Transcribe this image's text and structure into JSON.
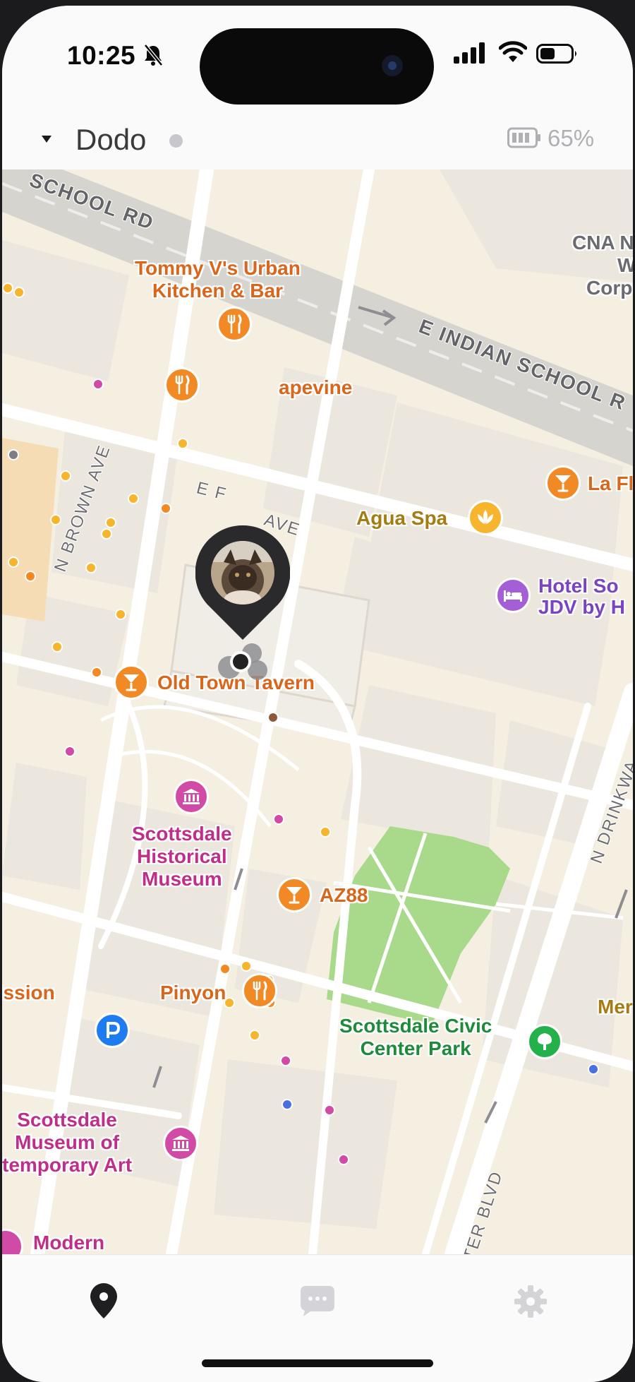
{
  "status_bar": {
    "time": "10:25",
    "icons": [
      "bell-slash-icon",
      "cellular-signal-icon",
      "wifi-icon",
      "battery-icon"
    ]
  },
  "header": {
    "device_name": "Dodo",
    "status_dot_color": "#c7c7cc",
    "battery_percent": "65%",
    "icons": [
      "dropdown-caret-icon",
      "battery-icon"
    ]
  },
  "map": {
    "roads": {
      "school_rd": "SCHOOL RD",
      "indian_school": "E INDIAN SCHOOL R",
      "brown_ave": "N BROWN AVE",
      "first_ave": "E F",
      "first_ave_end": "AVE",
      "drinkwater": "N DRINKWA",
      "civic_blvd": "TER BLVD"
    },
    "places": {
      "tommy": "Tommy V's Urban\nKitchen & Bar",
      "grapevine": "apevine",
      "la_fl": "La Fl",
      "agua_spa": "Agua Spa",
      "hotel_line1": "Hotel So",
      "hotel_line2": "JDV by H",
      "old_town_tavern": "Old Town Tavern",
      "historical_museum": "Scottsdale\nHistorical\nMuseum",
      "az88": "AZ88",
      "mission": "lission",
      "pinyon": "Pinyon",
      "civic_center_park": "Scottsdale Civic\nCenter Park",
      "contemporary_art": "Scottsdale\nMuseum of\ntemporary Art",
      "modern": "Modern",
      "mer": "Mer",
      "cna_line1": "CNA N",
      "cna_line2": "W",
      "cna_line3": "Corp"
    },
    "colors": {
      "restaurant": "#f18a24",
      "spa": "#f6b52d",
      "hotel": "#a45ed6",
      "museum": "#d14aa6",
      "parking": "#1e7cf2",
      "park": "#24b04a"
    },
    "icons": [
      "fork-knife-icon",
      "cocktail-icon",
      "lotus-icon",
      "bed-icon",
      "museum-icon",
      "parking-icon",
      "tree-icon",
      "location-pin-icon"
    ]
  },
  "tabbar": {
    "tabs": [
      "map-pin-icon",
      "chat-icon",
      "settings-gear-icon"
    ],
    "active": "map-pin-icon"
  }
}
